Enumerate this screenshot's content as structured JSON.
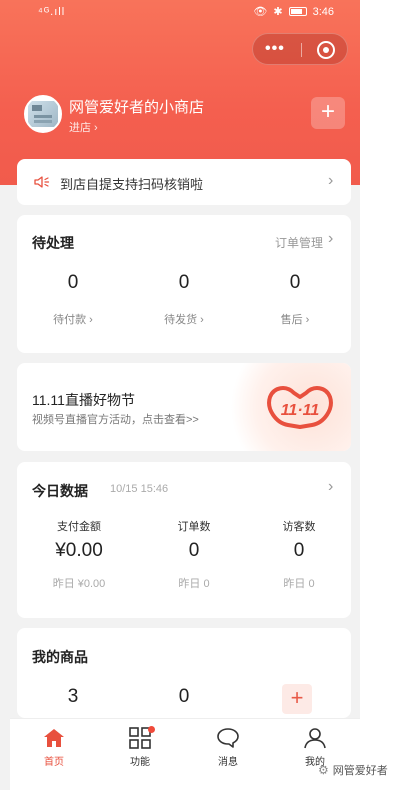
{
  "status_bar": {
    "signal": "⁴ᴳ.ıll",
    "time": "3:46"
  },
  "store": {
    "name": "网管爱好者的小商店",
    "enter_label": "进店 ›",
    "add_symbol": "+"
  },
  "notice": {
    "text": "到店自提支持扫码核销啦"
  },
  "pending": {
    "title": "待处理",
    "link": "订单管理",
    "stats": [
      {
        "value": "0",
        "label": "待付款 ›"
      },
      {
        "value": "0",
        "label": "待发货 ›"
      },
      {
        "value": "0",
        "label": "售后 ›"
      }
    ]
  },
  "promo": {
    "title": "11.11直播好物节",
    "subtitle": "视频号直播官方活动，点击查看>>",
    "badge": "11·11"
  },
  "today": {
    "title": "今日数据",
    "time": "10/15 15:46",
    "stats": [
      {
        "label": "支付金额",
        "value": "¥0.00",
        "yesterday": "昨日 ¥0.00"
      },
      {
        "label": "订单数",
        "value": "0",
        "yesterday": "昨日 0"
      },
      {
        "label": "访客数",
        "value": "0",
        "yesterday": "昨日 0"
      }
    ]
  },
  "goods": {
    "title": "我的商品",
    "values": [
      "3",
      "0"
    ],
    "add_symbol": "+"
  },
  "tabs": [
    {
      "label": "首页",
      "icon": "home-icon"
    },
    {
      "label": "功能",
      "icon": "grid-icon"
    },
    {
      "label": "消息",
      "icon": "chat-icon"
    },
    {
      "label": "我的",
      "icon": "user-icon"
    }
  ],
  "watermark": "网管爱好者",
  "colors": {
    "brand": "#f15b4c",
    "active_tab": "#e8503e",
    "background": "#f2f2f2"
  }
}
